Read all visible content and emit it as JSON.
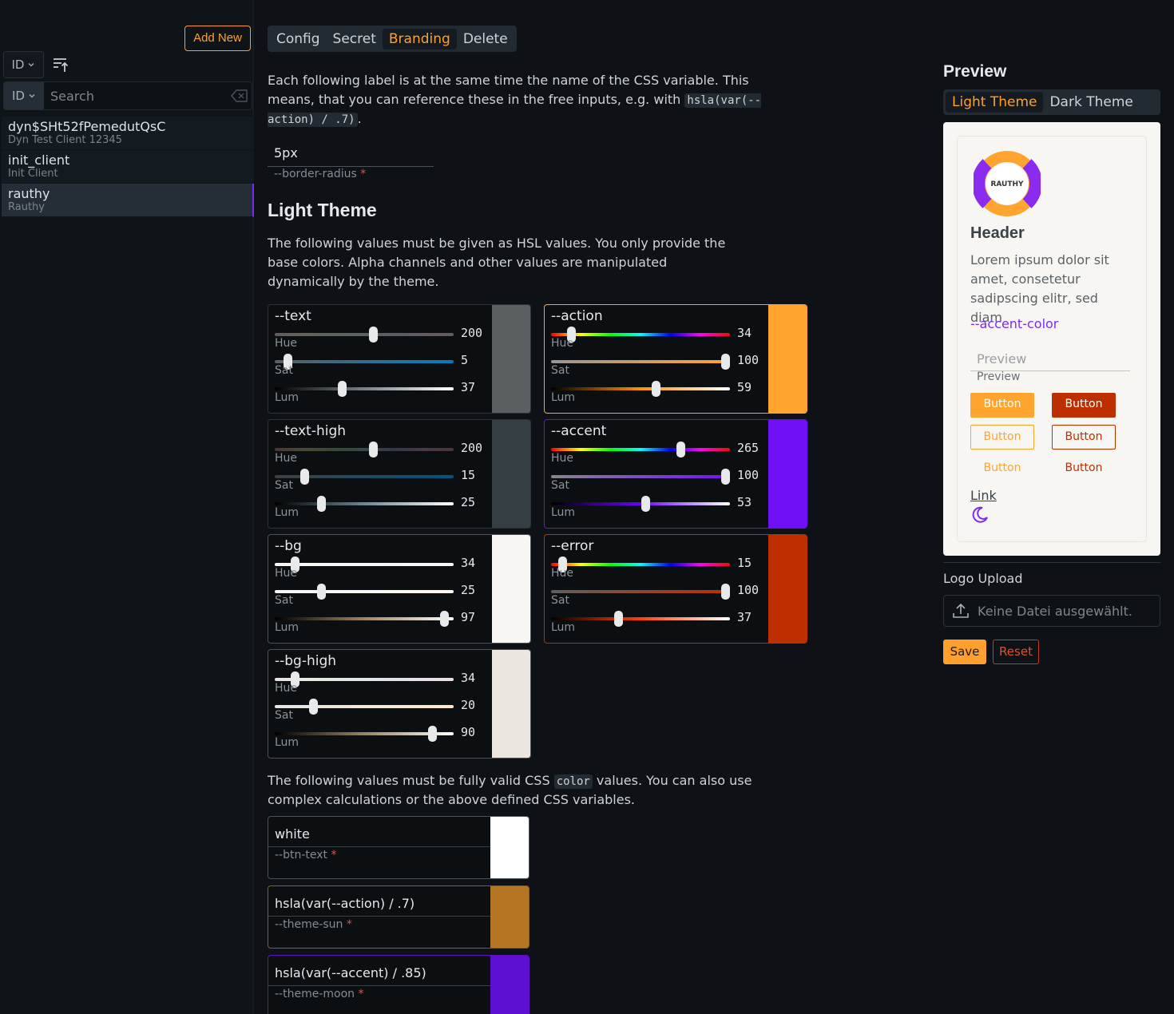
{
  "sidebar": {
    "add_new": "Add New",
    "sort_select": "ID",
    "search_select": "ID",
    "search_placeholder": "Search",
    "clients": [
      {
        "id": "dyn$SHt52fPemedutQsC",
        "name": "Dyn Test Client 12345"
      },
      {
        "id": "init_client",
        "name": "Init Client"
      },
      {
        "id": "rauthy",
        "name": "Rauthy"
      }
    ]
  },
  "tabs": [
    "Config",
    "Secret",
    "Branding",
    "Delete"
  ],
  "intro": {
    "text1": "Each following label is at the same time the name of the CSS variable. This means, that you can reference these in the free inputs, e.g. with ",
    "code": "hsla(var(--action) / .7)",
    "text2": "."
  },
  "border_radius": {
    "value": "5px",
    "label": "--border-radius",
    "required": "*"
  },
  "light_theme": {
    "title": "Light Theme",
    "desc": "The following values must be given as HSL values. You only provide the base colors. Alpha channels and other values are manipulated dynamically by the theme."
  },
  "slider_labels": {
    "hue": "Hue",
    "sat": "Sat",
    "lum": "Lum"
  },
  "hsl_cards": [
    {
      "name": "--text",
      "h": 200,
      "s": 5,
      "l": 37,
      "color": "#5a5f62",
      "col": 0,
      "row": 0
    },
    {
      "name": "--action",
      "h": 34,
      "s": 100,
      "l": 59,
      "color": "#ffa42e",
      "col": 1,
      "row": 0
    },
    {
      "name": "--text-high",
      "h": 200,
      "s": 15,
      "l": 25,
      "color": "#363f44",
      "col": 0,
      "row": 1
    },
    {
      "name": "--accent",
      "h": 265,
      "s": 100,
      "l": 53,
      "color": "#6f0ff5",
      "col": 1,
      "row": 1
    },
    {
      "name": "--bg",
      "h": 34,
      "s": 25,
      "l": 97,
      "color": "#f9f7f4",
      "col": 0,
      "row": 2
    },
    {
      "name": "--error",
      "h": 15,
      "s": 100,
      "l": 37,
      "color": "#bd2f00",
      "col": 1,
      "row": 2
    },
    {
      "name": "--bg-high",
      "h": 34,
      "s": 20,
      "l": 90,
      "color": "#ebe6e0",
      "col": 0,
      "row": 3
    }
  ],
  "free_desc": {
    "text1": "The following values must be fully valid CSS ",
    "code": "color",
    "text2": " values. You can also use complex calculations or the above defined CSS variables."
  },
  "free_inputs": [
    {
      "value": "white",
      "label": "--btn-text",
      "color": "#ffffff",
      "border": "#4b535a"
    },
    {
      "value": "hsla(var(--action) / .7)",
      "label": "--theme-sun",
      "color": "#b57623",
      "border": "#8a5a1c"
    },
    {
      "value": "hsla(var(--accent) / .85)",
      "label": "--theme-moon",
      "color": "#5e0fd1",
      "border": "#5a14c2"
    }
  ],
  "preview": {
    "title": "Preview",
    "tabs": [
      "Light Theme",
      "Dark Theme"
    ],
    "logo_text": "RAUTHY",
    "header": "Header",
    "lorem": "Lorem ipsum dolor sit amet, consetetur sadipscing elitr, sed diam",
    "accent": "--accent-color",
    "input_placeholder": "Preview",
    "input_label": "Preview",
    "button": "Button",
    "link": "Link"
  },
  "logo_upload": {
    "label": "Logo Upload",
    "placeholder": "Keine Datei ausgewählt."
  },
  "actions": {
    "save": "Save",
    "reset": "Reset"
  }
}
